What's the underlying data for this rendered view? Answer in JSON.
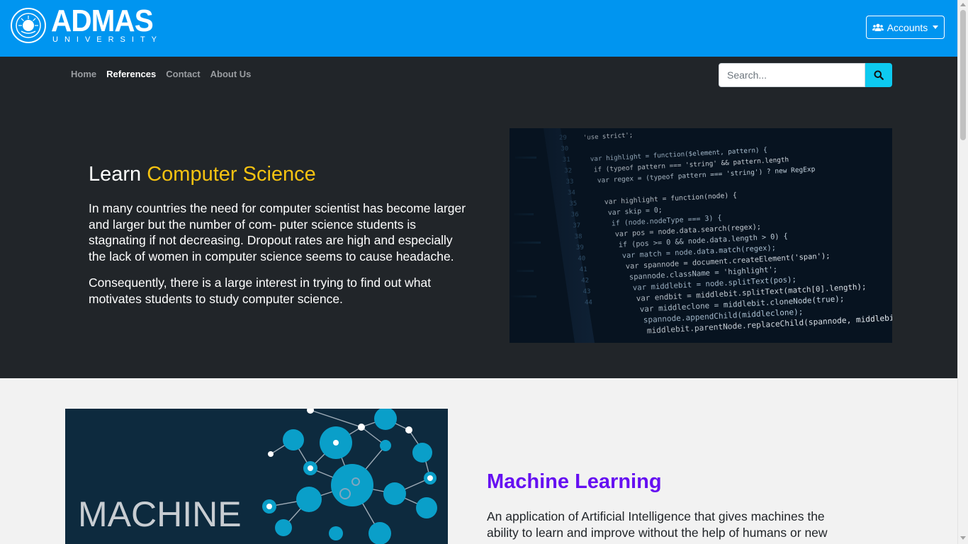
{
  "header": {
    "logo_name": "ADMAS",
    "logo_sub": "UNIVERSITY",
    "accounts_label": "Accounts"
  },
  "nav": {
    "items": [
      {
        "label": "Home",
        "active": false
      },
      {
        "label": "References",
        "active": true
      },
      {
        "label": "Contact",
        "active": false
      },
      {
        "label": "About Us",
        "active": false
      }
    ]
  },
  "search": {
    "placeholder": "Search..."
  },
  "hero": {
    "title_prefix": "Learn ",
    "title_highlight": "Computer Science",
    "paragraph_1": "In many countries the need for computer scientist has become larger and larger but the number of com- puter science students is stagnating if not decreasing. Dropout rates are high and especially the lack of women in computer science seems to cause headache.",
    "paragraph_2": "Consequently, there is a large interest in trying to find out what motivates students to study computer science."
  },
  "code_image": {
    "line_numbers": [
      "29",
      "30",
      "31",
      "32",
      "33",
      "34",
      "35",
      "36",
      "37",
      "38",
      "39",
      "40",
      "41",
      "42",
      "43",
      "44"
    ],
    "lines": [
      "'use strict';",
      "",
      "var highlight = function($element, pattern) {",
      "  if (typeof pattern === 'string' && pattern.length",
      "  var regex = (typeof pattern === 'string') ? new RegExp",
      "",
      "  var highlight = function(node) {",
      "    var skip = 0;",
      "    if (node.nodeType === 3) {",
      "      var pos = node.data.search(regex);",
      "      if (pos >= 0 && node.data.length > 0) {",
      "        var match = node.data.match(regex);",
      "        var spannode = document.createElement('span');",
      "        spannode.className = 'highlight';",
      "        var middlebit = node.splitText(pos);",
      "        var endbit = middlebit.splitText(match[0].length);",
      "        var middleclone = middlebit.cloneNode(true);",
      "        spannode.appendChild(middleclone);",
      "        middlebit.parentNode.replaceChild(spannode, middlebit);"
    ]
  },
  "ml_image": {
    "caption": "MACHINE"
  },
  "ml_section": {
    "title": "Machine Learning",
    "paragraph": "An application of Artificial Intelligence that gives machines the ability to learn and improve without the help of humans or new"
  },
  "colors": {
    "header_bg": "#0095f0",
    "hero_bg": "#212529",
    "highlight": "#f5c211",
    "ml_title": "#6610f2",
    "search_btn": "#0dcaf0"
  }
}
